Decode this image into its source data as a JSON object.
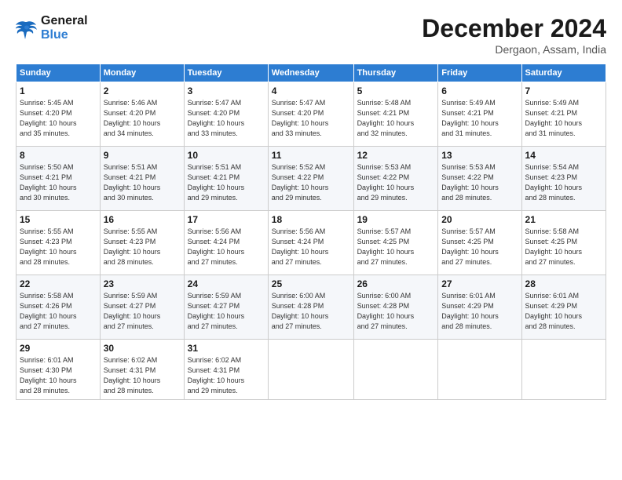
{
  "header": {
    "logo_line1": "General",
    "logo_line2": "Blue",
    "month": "December 2024",
    "location": "Dergaon, Assam, India"
  },
  "weekdays": [
    "Sunday",
    "Monday",
    "Tuesday",
    "Wednesday",
    "Thursday",
    "Friday",
    "Saturday"
  ],
  "weeks": [
    [
      {
        "day": "1",
        "info": "Sunrise: 5:45 AM\nSunset: 4:20 PM\nDaylight: 10 hours\nand 35 minutes."
      },
      {
        "day": "2",
        "info": "Sunrise: 5:46 AM\nSunset: 4:20 PM\nDaylight: 10 hours\nand 34 minutes."
      },
      {
        "day": "3",
        "info": "Sunrise: 5:47 AM\nSunset: 4:20 PM\nDaylight: 10 hours\nand 33 minutes."
      },
      {
        "day": "4",
        "info": "Sunrise: 5:47 AM\nSunset: 4:20 PM\nDaylight: 10 hours\nand 33 minutes."
      },
      {
        "day": "5",
        "info": "Sunrise: 5:48 AM\nSunset: 4:21 PM\nDaylight: 10 hours\nand 32 minutes."
      },
      {
        "day": "6",
        "info": "Sunrise: 5:49 AM\nSunset: 4:21 PM\nDaylight: 10 hours\nand 31 minutes."
      },
      {
        "day": "7",
        "info": "Sunrise: 5:49 AM\nSunset: 4:21 PM\nDaylight: 10 hours\nand 31 minutes."
      }
    ],
    [
      {
        "day": "8",
        "info": "Sunrise: 5:50 AM\nSunset: 4:21 PM\nDaylight: 10 hours\nand 30 minutes."
      },
      {
        "day": "9",
        "info": "Sunrise: 5:51 AM\nSunset: 4:21 PM\nDaylight: 10 hours\nand 30 minutes."
      },
      {
        "day": "10",
        "info": "Sunrise: 5:51 AM\nSunset: 4:21 PM\nDaylight: 10 hours\nand 29 minutes."
      },
      {
        "day": "11",
        "info": "Sunrise: 5:52 AM\nSunset: 4:22 PM\nDaylight: 10 hours\nand 29 minutes."
      },
      {
        "day": "12",
        "info": "Sunrise: 5:53 AM\nSunset: 4:22 PM\nDaylight: 10 hours\nand 29 minutes."
      },
      {
        "day": "13",
        "info": "Sunrise: 5:53 AM\nSunset: 4:22 PM\nDaylight: 10 hours\nand 28 minutes."
      },
      {
        "day": "14",
        "info": "Sunrise: 5:54 AM\nSunset: 4:23 PM\nDaylight: 10 hours\nand 28 minutes."
      }
    ],
    [
      {
        "day": "15",
        "info": "Sunrise: 5:55 AM\nSunset: 4:23 PM\nDaylight: 10 hours\nand 28 minutes."
      },
      {
        "day": "16",
        "info": "Sunrise: 5:55 AM\nSunset: 4:23 PM\nDaylight: 10 hours\nand 28 minutes."
      },
      {
        "day": "17",
        "info": "Sunrise: 5:56 AM\nSunset: 4:24 PM\nDaylight: 10 hours\nand 27 minutes."
      },
      {
        "day": "18",
        "info": "Sunrise: 5:56 AM\nSunset: 4:24 PM\nDaylight: 10 hours\nand 27 minutes."
      },
      {
        "day": "19",
        "info": "Sunrise: 5:57 AM\nSunset: 4:25 PM\nDaylight: 10 hours\nand 27 minutes."
      },
      {
        "day": "20",
        "info": "Sunrise: 5:57 AM\nSunset: 4:25 PM\nDaylight: 10 hours\nand 27 minutes."
      },
      {
        "day": "21",
        "info": "Sunrise: 5:58 AM\nSunset: 4:25 PM\nDaylight: 10 hours\nand 27 minutes."
      }
    ],
    [
      {
        "day": "22",
        "info": "Sunrise: 5:58 AM\nSunset: 4:26 PM\nDaylight: 10 hours\nand 27 minutes."
      },
      {
        "day": "23",
        "info": "Sunrise: 5:59 AM\nSunset: 4:27 PM\nDaylight: 10 hours\nand 27 minutes."
      },
      {
        "day": "24",
        "info": "Sunrise: 5:59 AM\nSunset: 4:27 PM\nDaylight: 10 hours\nand 27 minutes."
      },
      {
        "day": "25",
        "info": "Sunrise: 6:00 AM\nSunset: 4:28 PM\nDaylight: 10 hours\nand 27 minutes."
      },
      {
        "day": "26",
        "info": "Sunrise: 6:00 AM\nSunset: 4:28 PM\nDaylight: 10 hours\nand 27 minutes."
      },
      {
        "day": "27",
        "info": "Sunrise: 6:01 AM\nSunset: 4:29 PM\nDaylight: 10 hours\nand 28 minutes."
      },
      {
        "day": "28",
        "info": "Sunrise: 6:01 AM\nSunset: 4:29 PM\nDaylight: 10 hours\nand 28 minutes."
      }
    ],
    [
      {
        "day": "29",
        "info": "Sunrise: 6:01 AM\nSunset: 4:30 PM\nDaylight: 10 hours\nand 28 minutes."
      },
      {
        "day": "30",
        "info": "Sunrise: 6:02 AM\nSunset: 4:31 PM\nDaylight: 10 hours\nand 28 minutes."
      },
      {
        "day": "31",
        "info": "Sunrise: 6:02 AM\nSunset: 4:31 PM\nDaylight: 10 hours\nand 29 minutes."
      },
      {
        "day": "",
        "info": ""
      },
      {
        "day": "",
        "info": ""
      },
      {
        "day": "",
        "info": ""
      },
      {
        "day": "",
        "info": ""
      }
    ]
  ]
}
